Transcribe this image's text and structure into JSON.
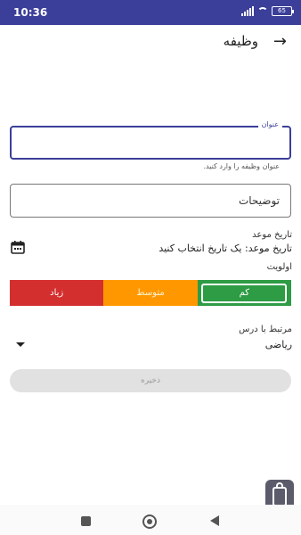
{
  "status_bar": {
    "time": "10:36",
    "battery": "65",
    "color": "#3b3f99"
  },
  "app_bar": {
    "title": "وظیفه",
    "back_icon": "arrow-right-icon"
  },
  "form": {
    "title_field": {
      "label": "عنوان",
      "value": "",
      "helper": "عنوان وظیفه را وارد کنید."
    },
    "description_field": {
      "placeholder": "توضیحات"
    },
    "due_date": {
      "label": "تاریخ موعد",
      "value": "تاریخ موعد: یک تاریخ انتخاب کنید",
      "icon": "calendar-icon"
    },
    "priority": {
      "label": "اولویت",
      "options": [
        "کم",
        "متوسط",
        "زیاد"
      ],
      "selected": "کم",
      "colors": {
        "low": "#2e9b45",
        "medium": "#ff9800",
        "high": "#d32f2f"
      }
    },
    "course": {
      "label": "مرتبط با درس",
      "value": "ریاضی"
    },
    "save_label": "ذخیره"
  },
  "nav_bar": {
    "icons": [
      "recents-icon",
      "home-icon",
      "back-icon"
    ]
  }
}
